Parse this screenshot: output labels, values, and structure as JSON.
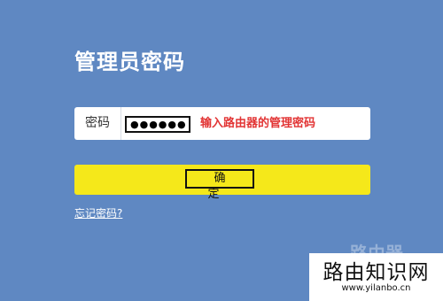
{
  "page": {
    "title": "管理员密码",
    "background_color": "#5f88c2"
  },
  "password": {
    "label": "密码",
    "value": "●●●●●●",
    "hint": "输入路由器的管理密码",
    "hint_color": "#e23434"
  },
  "actions": {
    "confirm_label": "确 定",
    "confirm_color": "#f5e81a",
    "forgot_label": "忘记密码?"
  },
  "watermark": {
    "faint_text": "路由器",
    "title": "路由知识网",
    "url": "www.yilanbo.cn"
  }
}
